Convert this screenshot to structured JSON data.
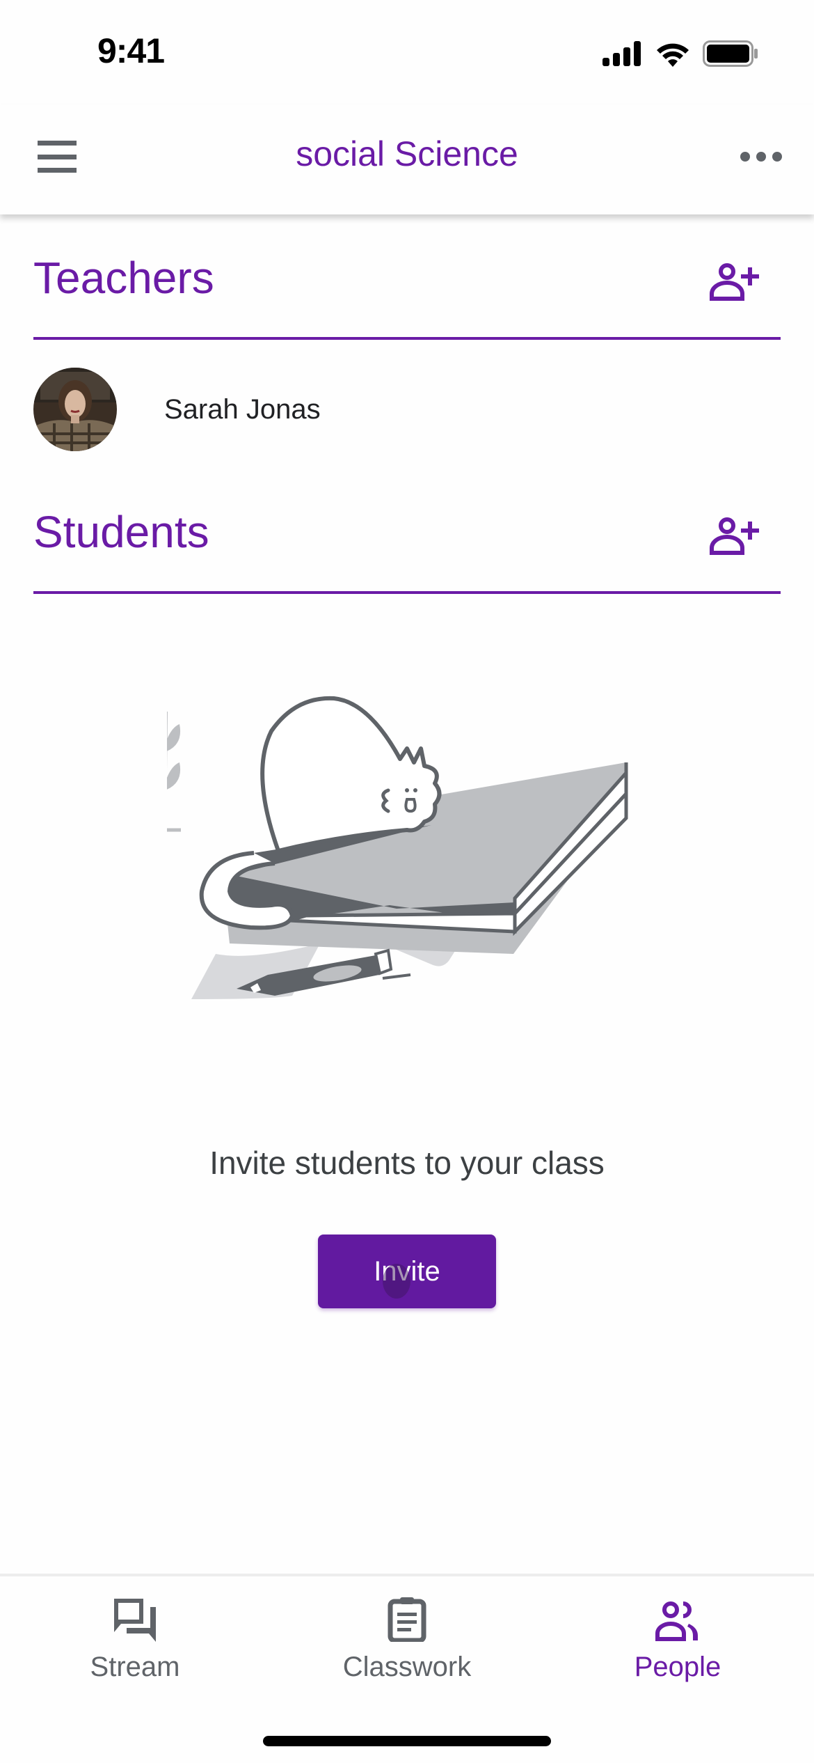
{
  "status_bar": {
    "time": "9:41",
    "icons": [
      "cellular-signal-icon",
      "wifi-icon",
      "battery-icon"
    ]
  },
  "app_bar": {
    "title": "social Science",
    "left_icon": "menu-icon",
    "right_icon": "more-horizontal-icon"
  },
  "teachers": {
    "title": "Teachers",
    "action_icon": "add-person-icon",
    "people": [
      {
        "name": "Sarah Jonas"
      }
    ]
  },
  "students": {
    "title": "Students",
    "action_icon": "add-person-icon",
    "empty_state": {
      "illustration": "cat-sleeping-on-book-illustration",
      "message": "Invite students to your class",
      "button_label": "Invite"
    }
  },
  "bottom_nav": {
    "items": [
      {
        "label": "Stream",
        "icon": "stream-icon",
        "active": false
      },
      {
        "label": "Classwork",
        "icon": "classwork-icon",
        "active": false
      },
      {
        "label": "People",
        "icon": "people-icon",
        "active": true
      }
    ]
  },
  "colors": {
    "accent": "#6a1ba6",
    "button": "#621aa0",
    "icon_gray": "#5f6368",
    "text_dark": "#202124"
  }
}
